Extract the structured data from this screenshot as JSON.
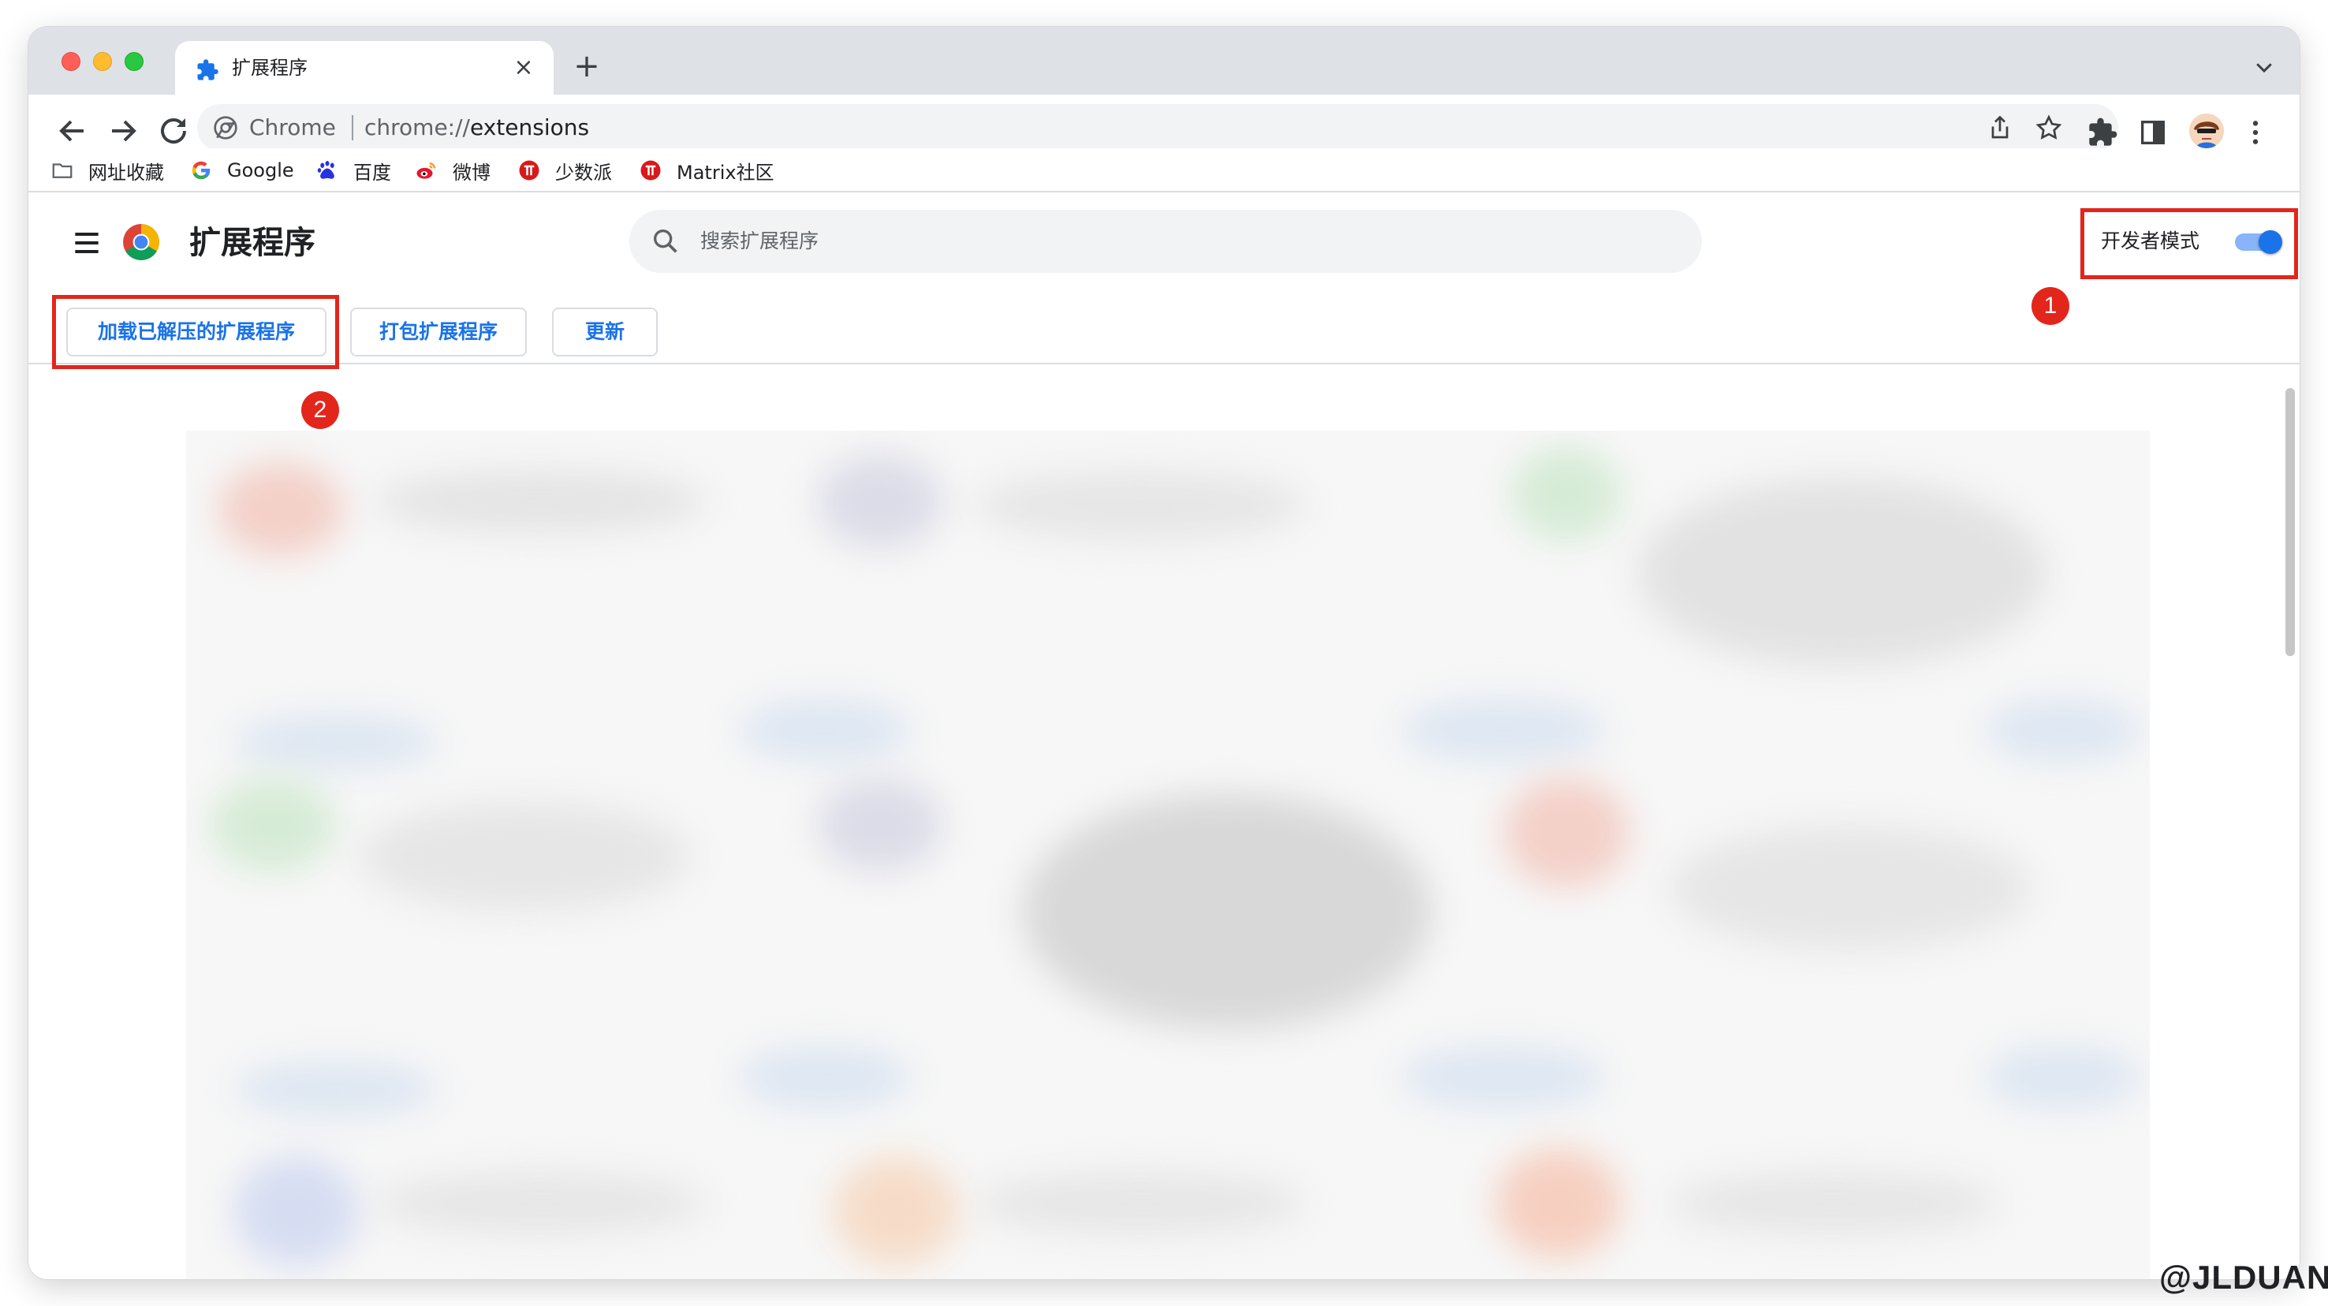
{
  "tab": {
    "title": "扩展程序",
    "close_symbol": "×",
    "new_tab_symbol": "+"
  },
  "omnibox": {
    "site_label": "Chrome",
    "url_scheme": "chrome://",
    "url_host": "extensions"
  },
  "bookmarks": [
    {
      "label": "网址收藏",
      "icon": "folder-icon"
    },
    {
      "label": "Google",
      "icon": "google-icon"
    },
    {
      "label": "百度",
      "icon": "baidu-icon"
    },
    {
      "label": "微博",
      "icon": "weibo-icon"
    },
    {
      "label": "少数派",
      "icon": "sspai-icon"
    },
    {
      "label": "Matrix社区",
      "icon": "sspai-icon"
    }
  ],
  "header": {
    "title": "扩展程序",
    "search_placeholder": "搜索扩展程序",
    "dev_mode_label": "开发者模式",
    "dev_mode_on": true
  },
  "buttons": {
    "load_unpacked": "加载已解压的扩展程序",
    "pack": "打包扩展程序",
    "update": "更新"
  },
  "annotations": {
    "badge1": "1",
    "badge2": "2"
  },
  "watermark": "@JLDUAN",
  "colors": {
    "accent": "#1a73e8",
    "annotation_red": "#e3261b",
    "tab_strip": "#dee1e6"
  }
}
